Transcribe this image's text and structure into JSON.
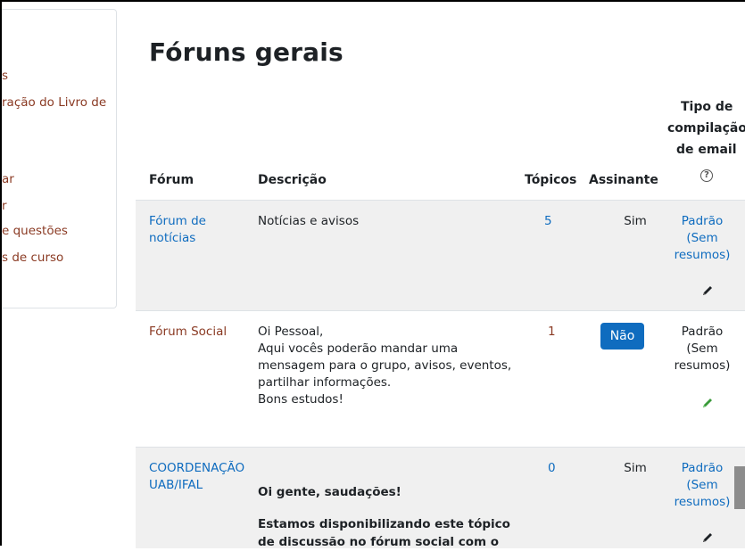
{
  "sidebar": {
    "items": [
      {
        "label": "s"
      },
      {
        "label": "ração do Livro de"
      },
      {
        "label": "ar"
      },
      {
        "label": "r"
      },
      {
        "label": "e questões"
      },
      {
        "label": "s de curso"
      }
    ]
  },
  "page_title": "Fóruns gerais",
  "table": {
    "headers": {
      "forum": "Fórum",
      "descricao": "Descrição",
      "topicos": "Tópicos",
      "assinante": "Assinante",
      "tipo_line1": "Tipo de",
      "tipo_line2": "compilação",
      "tipo_line3": "de email",
      "help_icon": "?"
    },
    "rows": [
      {
        "forum_line1": "Fórum de",
        "forum_line2": "notícias",
        "desc_lines": [
          "Notícias e avisos"
        ],
        "topicos": "5",
        "assinante": "Sim",
        "tipo_line1": "Padrão",
        "tipo_line2": "(Sem",
        "tipo_line3": "resumos)"
      },
      {
        "forum_line1": "Fórum Social",
        "desc_lines": [
          "Oi Pessoal,",
          "Aqui vocês poderão mandar uma",
          "mensagem para o grupo, avisos, eventos,",
          "partilhar informações.",
          "Bons estudos!"
        ],
        "topicos": "1",
        "assinante": "Não",
        "tipo_line1": "Padrão",
        "tipo_line2": "(Sem",
        "tipo_line3": "resumos)"
      },
      {
        "forum_line1": "COORDENAÇÃO",
        "forum_line2": "UAB/IFAL",
        "desc_bold1": "Oi gente, saudações!",
        "desc_bold2": "Estamos disponibilizando este tópico",
        "desc_bold3": "de discussão no fórum social com o",
        "topicos": "0",
        "assinante": "Sim",
        "tipo_line1": "Padrão",
        "tipo_line2": "(Sem",
        "tipo_line3": "resumos)"
      }
    ]
  },
  "colors": {
    "link_blue": "#0f6cbf",
    "link_red": "#8a3a23",
    "pencil_dark": "#1d2125",
    "pencil_green": "#3a9a3a",
    "button_blue": "#0f6cbf"
  },
  "icons": [
    "help-icon",
    "pencil-icon"
  ]
}
